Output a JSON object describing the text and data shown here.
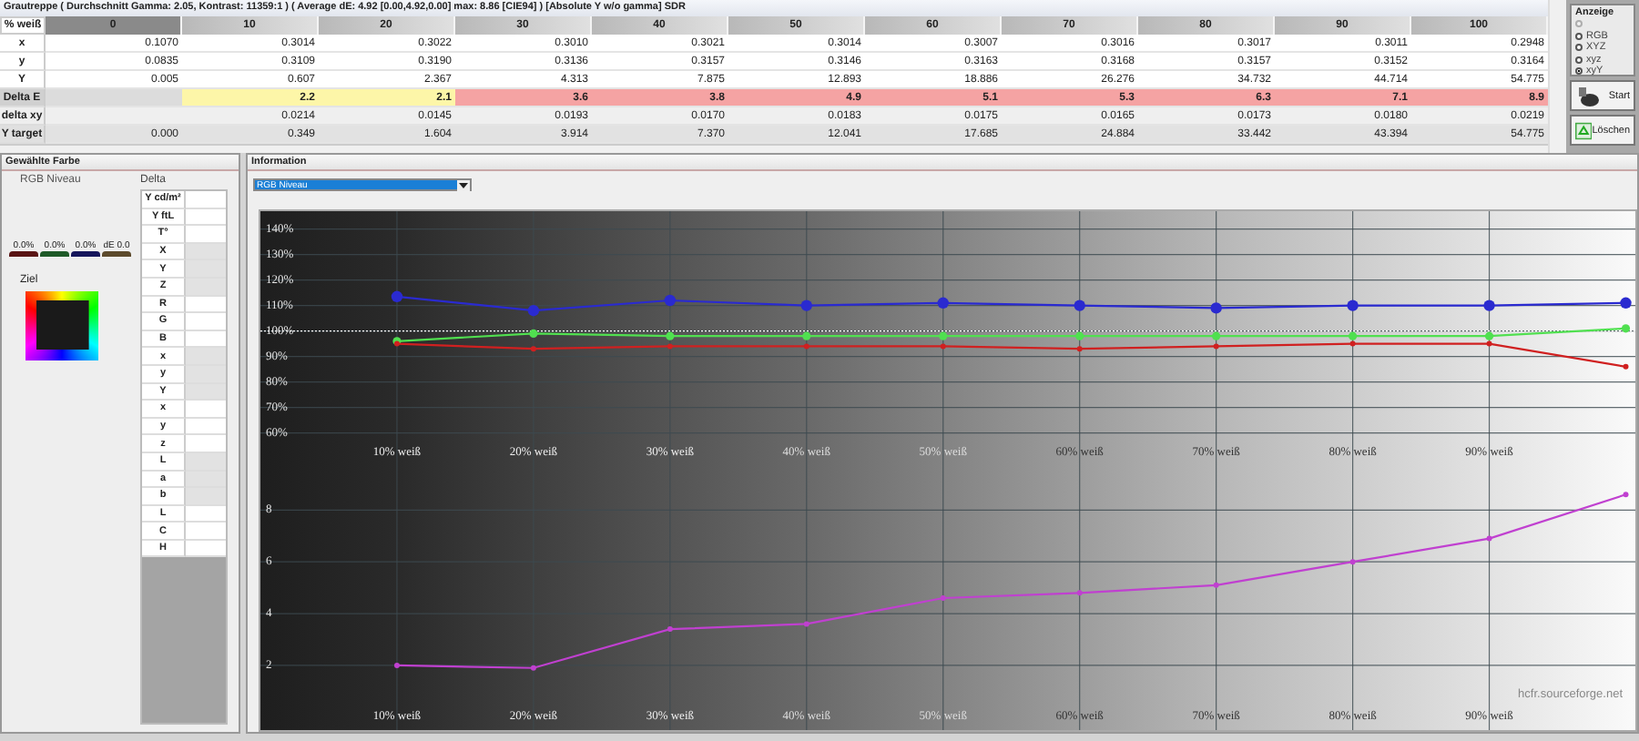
{
  "title": "Grautreppe ( Durchschnitt Gamma: 2.05, Kontrast: 11359:1 ) ( Average dE: 4.92 [0.00,4.92,0.00] max: 8.86 [CIE94] ) [Absolute Y w/o gamma] SDR",
  "table": {
    "corner": "% weiß",
    "columns": [
      "0",
      "10",
      "20",
      "30",
      "40",
      "50",
      "60",
      "70",
      "80",
      "90",
      "100"
    ],
    "rows": [
      {
        "label": "x",
        "kind": "plain",
        "cells": [
          "0.1070",
          "0.3014",
          "0.3022",
          "0.3010",
          "0.3021",
          "0.3014",
          "0.3007",
          "0.3016",
          "0.3017",
          "0.3011",
          "0.2948"
        ]
      },
      {
        "label": "y",
        "kind": "plain",
        "cells": [
          "0.0835",
          "0.3109",
          "0.3190",
          "0.3136",
          "0.3157",
          "0.3146",
          "0.3163",
          "0.3168",
          "0.3157",
          "0.3152",
          "0.3164"
        ]
      },
      {
        "label": "Y",
        "kind": "plain",
        "cells": [
          "0.005",
          "0.607",
          "2.367",
          "4.313",
          "7.875",
          "12.893",
          "18.886",
          "26.276",
          "34.732",
          "44.714",
          "54.775"
        ]
      },
      {
        "label": "Delta E",
        "kind": "graded",
        "cells": [
          {
            "color": "#dcdcdc"
          },
          {
            "text": "2.2",
            "color": "#fdf6a8"
          },
          {
            "text": "2.1",
            "color": "#fdf6a8"
          },
          {
            "text": "3.6",
            "color": "#f5a3a3"
          },
          {
            "text": "3.8",
            "color": "#f5a3a3"
          },
          {
            "text": "4.9",
            "color": "#f5a3a3"
          },
          {
            "text": "5.1",
            "color": "#f5a3a3"
          },
          {
            "text": "5.3",
            "color": "#f5a3a3"
          },
          {
            "text": "6.3",
            "color": "#f5a3a3"
          },
          {
            "text": "7.1",
            "color": "#f5a3a3"
          },
          {
            "text": "8.9",
            "color": "#f5a3a3"
          }
        ]
      },
      {
        "label": "delta xy",
        "kind": "shaded",
        "cells": [
          null,
          "0.0214",
          "0.0145",
          "0.0193",
          "0.0170",
          "0.0183",
          "0.0175",
          "0.0165",
          "0.0173",
          "0.0180",
          "0.0219"
        ]
      },
      {
        "label": "Y target",
        "kind": "dark",
        "cells": [
          "0.000",
          "0.349",
          "1.604",
          "3.914",
          "7.370",
          "12.041",
          "17.685",
          "24.884",
          "33.442",
          "43.394",
          "54.775"
        ]
      }
    ]
  },
  "display": {
    "title": "Anzeige",
    "options": [
      {
        "disabled": true,
        "selected": false
      },
      {
        "label": "RGB",
        "disabled": false,
        "selected": false
      },
      {
        "label": "XYZ",
        "disabled": false,
        "selected": false
      },
      {
        "label": "xyz",
        "disabled": false,
        "selected": false
      },
      {
        "label": "xyY",
        "disabled": false,
        "selected": true
      }
    ]
  },
  "buttons": [
    {
      "label": "Start",
      "kind": "start"
    },
    {
      "label": "Löschen",
      "kind": "clear"
    }
  ],
  "selected_color": {
    "title": "Gewählte Farbe",
    "mode": "RGB Niveau",
    "levels": [
      {
        "label": "0.0%",
        "color": "#5a1414"
      },
      {
        "label": "0.0%",
        "color": "#1e5a28"
      },
      {
        "label": "0.0%",
        "color": "#16165c"
      },
      {
        "label": "dE 0.0",
        "color": "#5c4a2c"
      }
    ],
    "target_label": "Ziel",
    "delta_label": "Delta",
    "delta_rows": [
      {
        "label": "Y cd/m²",
        "disabled": false
      },
      {
        "label": "Y ftL",
        "disabled": false
      },
      {
        "label": "T°",
        "disabled": false
      },
      {
        "label": "X",
        "disabled": true
      },
      {
        "label": "Y",
        "disabled": true
      },
      {
        "label": "Z",
        "disabled": true
      },
      {
        "label": "R",
        "disabled": false
      },
      {
        "label": "G",
        "disabled": false
      },
      {
        "label": "B",
        "disabled": false
      },
      {
        "label": "x",
        "disabled": true
      },
      {
        "label": "y",
        "disabled": true
      },
      {
        "label": "Y",
        "disabled": true
      },
      {
        "label": "x",
        "disabled": false
      },
      {
        "label": "y",
        "disabled": false
      },
      {
        "label": "z",
        "disabled": false
      },
      {
        "label": "L",
        "disabled": true
      },
      {
        "label": "a",
        "disabled": true
      },
      {
        "label": "b",
        "disabled": true
      },
      {
        "label": "L",
        "disabled": false
      },
      {
        "label": "C",
        "disabled": false
      },
      {
        "label": "H",
        "disabled": false
      }
    ]
  },
  "information": {
    "title": "Information",
    "view": "RGB Niveau",
    "credit": "hcfr.sourceforge.net",
    "plots": [
      {
        "chart_data": {
          "type": "line",
          "x": [
            10,
            20,
            30,
            40,
            50,
            60,
            70,
            80,
            90,
            100
          ],
          "xlim": [
            0,
            100.7
          ],
          "ylim": [
            47,
            147
          ],
          "grid": true,
          "ref_lines": [
            {
              "axis": "y",
              "value": 100
            }
          ],
          "xticks": [
            {
              "value": 10,
              "label": "10% weiß"
            },
            {
              "value": 20,
              "label": "20% weiß"
            },
            {
              "value": 30,
              "label": "30% weiß"
            },
            {
              "value": 40,
              "label": "40% weiß"
            },
            {
              "value": 50,
              "label": "50% weiß"
            },
            {
              "value": 60,
              "label": "60% weiß"
            },
            {
              "value": 70,
              "label": "70% weiß"
            },
            {
              "value": 80,
              "label": "80% weiß"
            },
            {
              "value": 90,
              "label": "90% weiß"
            }
          ],
          "yticks": [
            {
              "value": 140,
              "label": "140%"
            },
            {
              "value": 130,
              "label": "130%"
            },
            {
              "value": 120,
              "label": "120%"
            },
            {
              "value": 110,
              "label": "110%"
            },
            {
              "value": 100,
              "label": "100%"
            },
            {
              "value": 90,
              "label": "90%"
            },
            {
              "value": 80,
              "label": "80%"
            },
            {
              "value": 70,
              "label": "70%"
            },
            {
              "value": 60,
              "label": "60%"
            }
          ],
          "series": [
            {
              "color": "#2a2ad0",
              "marker": "o",
              "values": [
                113.5,
                108,
                112,
                110,
                111,
                110,
                109,
                110,
                110,
                111
              ]
            },
            {
              "color": "#50e050",
              "marker": "o",
              "values": [
                96,
                99,
                98,
                98,
                98,
                98,
                98,
                98,
                98,
                101
              ]
            },
            {
              "color": "#d02020",
              "marker": "o",
              "values": [
                95,
                93,
                94,
                94,
                94,
                93,
                94,
                95,
                95,
                86
              ]
            }
          ]
        }
      },
      {
        "chart_data": {
          "type": "line",
          "x": [
            10,
            20,
            30,
            40,
            50,
            60,
            70,
            80,
            90,
            100
          ],
          "xlim": [
            0,
            100.7
          ],
          "ylim": [
            -0.5,
            9.7
          ],
          "grid": true,
          "xticks": [
            {
              "value": 10,
              "label": "10% weiß"
            },
            {
              "value": 20,
              "label": "20% weiß"
            },
            {
              "value": 30,
              "label": "30% weiß"
            },
            {
              "value": 40,
              "label": "40% weiß"
            },
            {
              "value": 50,
              "label": "50% weiß"
            },
            {
              "value": 60,
              "label": "60% weiß"
            },
            {
              "value": 70,
              "label": "70% weiß"
            },
            {
              "value": 80,
              "label": "80% weiß"
            },
            {
              "value": 90,
              "label": "90% weiß"
            }
          ],
          "yticks": [
            8,
            6,
            4,
            2
          ],
          "series": [
            {
              "color": "#c040d0",
              "marker": "o",
              "values": [
                2.0,
                1.9,
                3.4,
                3.6,
                4.6,
                4.8,
                5.1,
                6.0,
                6.9,
                8.6
              ]
            }
          ]
        }
      }
    ]
  }
}
